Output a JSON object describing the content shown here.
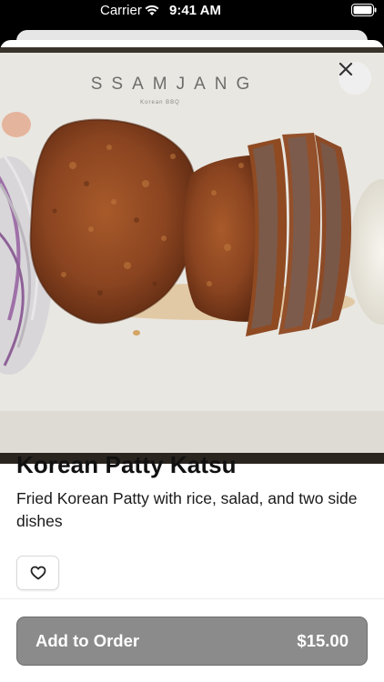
{
  "status_bar": {
    "carrier": "Carrier",
    "time": "9:41 AM"
  },
  "hero": {
    "restaurant_name": "SSAMJANG",
    "restaurant_subtitle": "Korean BBQ"
  },
  "item": {
    "title": "Korean Patty Katsu",
    "description": "Fried Korean Patty with rice, salad, and two side dishes"
  },
  "actions": {
    "add_label": "Add to Order",
    "price": "$15.00"
  },
  "icons": {
    "close": "close-icon",
    "favorite": "heart-icon",
    "wifi": "wifi-icon",
    "battery": "battery-icon"
  },
  "colors": {
    "button_bg": "#8b8b8b",
    "text": "#111111"
  }
}
